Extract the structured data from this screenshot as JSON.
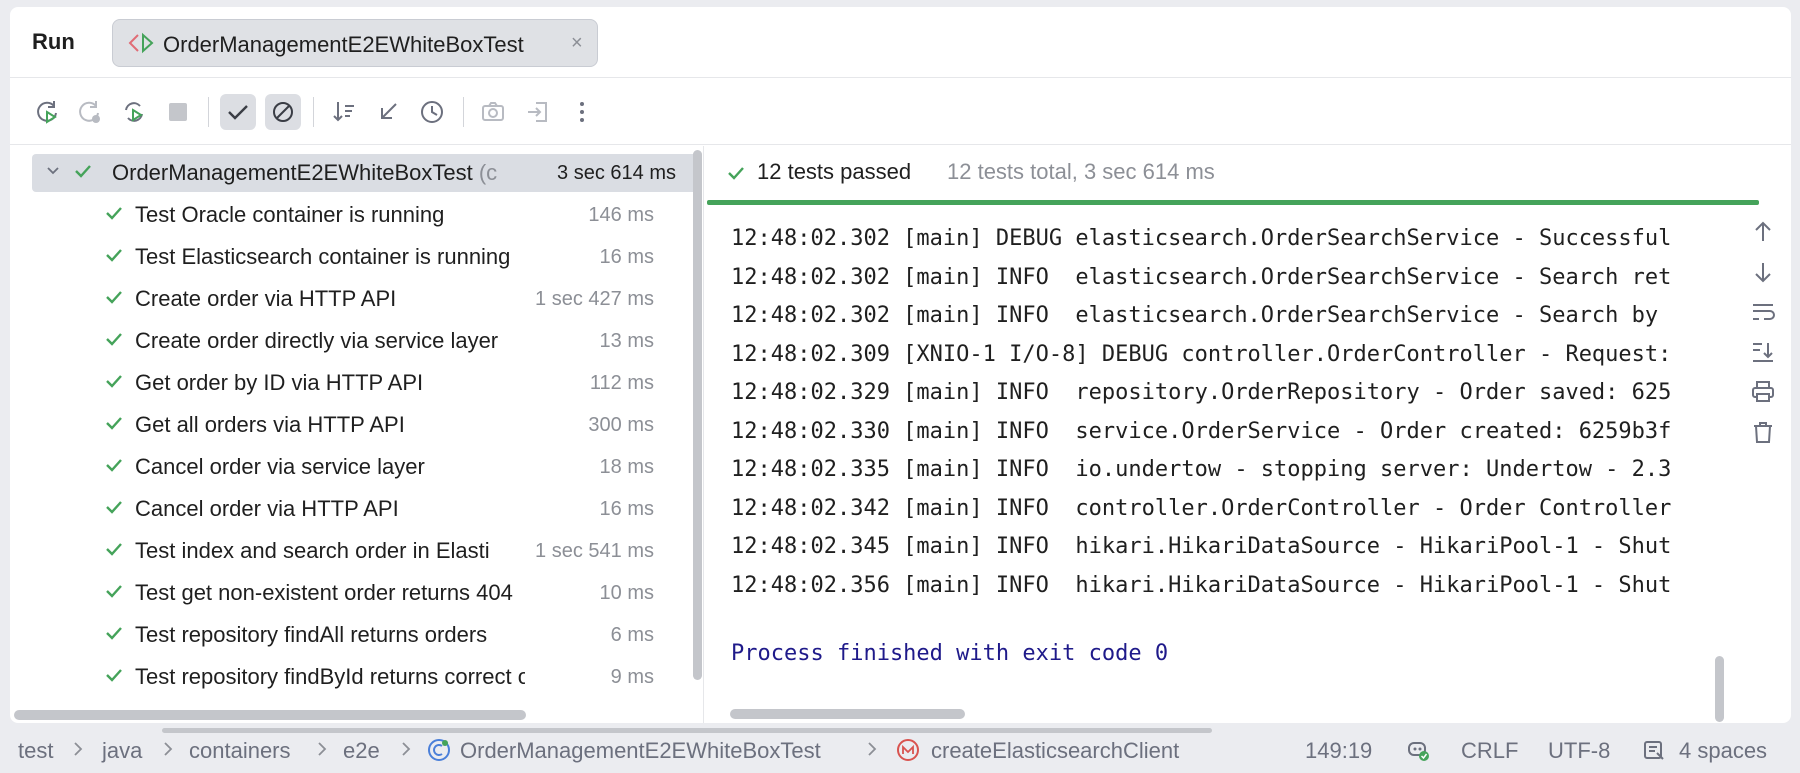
{
  "header": {
    "run_label": "Run",
    "tab_label": "OrderManagementE2EWhiteBoxTest",
    "tab_icon": "test-runner-icon",
    "tab_close": "×"
  },
  "toolbar": {
    "buttons": [
      "rerun-icon",
      "rerun-failed-icon",
      "rerun-auto-icon",
      "stop-icon",
      "show-passed-icon",
      "show-ignored-icon",
      "sort-icon",
      "collapse-icon",
      "history-icon",
      "camera-icon",
      "import-icon",
      "more-icon"
    ]
  },
  "tree": {
    "root": {
      "label": "OrderManagementE2EWhiteBoxTest",
      "suffix": "(c",
      "time": "3 sec 614 ms"
    },
    "items": [
      {
        "label": "Test Oracle container is running",
        "time": "146 ms"
      },
      {
        "label": "Test Elasticsearch container is running",
        "time": "16 ms"
      },
      {
        "label": "Create order via HTTP API",
        "time": "1 sec 427 ms"
      },
      {
        "label": "Create order directly via service layer",
        "time": "13 ms"
      },
      {
        "label": "Get order by ID via HTTP API",
        "time": "112 ms"
      },
      {
        "label": "Get all orders via HTTP API",
        "time": "300 ms"
      },
      {
        "label": "Cancel order via service layer",
        "time": "18 ms"
      },
      {
        "label": "Cancel order via HTTP API",
        "time": "16 ms"
      },
      {
        "label": "Test index and search order in Elasti",
        "time": "1 sec 541 ms"
      },
      {
        "label": "Test get non-existent order returns 404",
        "time": "10 ms"
      },
      {
        "label": "Test repository findAll returns orders",
        "time": "6 ms"
      },
      {
        "label": "Test repository findById returns correct orde",
        "time": "9 ms"
      }
    ]
  },
  "console": {
    "status_passed": "12 tests passed",
    "status_total": "12 tests total, 3 sec 614 ms",
    "progress_fraction": 1.0,
    "lines": [
      "12:48:02.302 [main] DEBUG elasticsearch.OrderSearchService - Successful",
      "12:48:02.302 [main] INFO  elasticsearch.OrderSearchService - Search ret",
      "12:48:02.302 [main] INFO  elasticsearch.OrderSearchService - Search by ",
      "12:48:02.309 [XNIO-1 I/O-8] DEBUG controller.OrderController - Request:",
      "12:48:02.329 [main] INFO  repository.OrderRepository - Order saved: 625",
      "12:48:02.330 [main] INFO  service.OrderService - Order created: 6259b3f",
      "12:48:02.335 [main] INFO  io.undertow - stopping server: Undertow - 2.3",
      "12:48:02.342 [main] INFO  controller.OrderController - Order Controller",
      "12:48:02.345 [main] INFO  hikari.HikariDataSource - HikariPool-1 - Shut",
      "12:48:02.356 [main] INFO  hikari.HikariDataSource - HikariPool-1 - Shut"
    ],
    "finish_line": "Process finished with exit code 0",
    "side_tools": [
      "arrow-up-icon",
      "arrow-down-icon",
      "soft-wrap-icon",
      "scroll-to-end-icon",
      "print-icon",
      "trash-icon"
    ]
  },
  "statusbar": {
    "breadcrumbs": [
      "test",
      "java",
      "containers",
      "e2e",
      "OrderManagementE2EWhiteBoxTest",
      "createElasticsearchClient"
    ],
    "position": "149:19",
    "line_ending": "CRLF",
    "encoding": "UTF-8",
    "indent": "4 spaces"
  },
  "colors": {
    "success_green": "#45a35a",
    "finish_text": "#1f1a8a",
    "muted_text": "#8c8f96"
  }
}
